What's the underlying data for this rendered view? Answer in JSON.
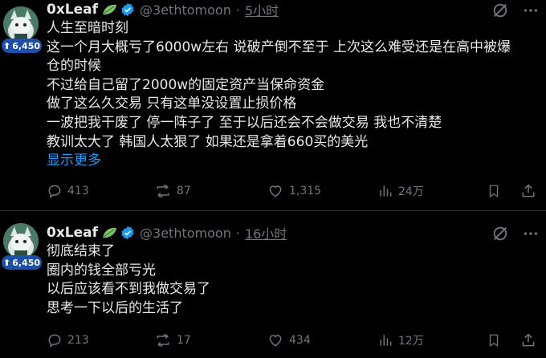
{
  "tweets": [
    {
      "author": "0xLeaf",
      "handle": "@3ethtomoon",
      "separator": "·",
      "time": "5小时",
      "badge_count": "6,450",
      "lines": [
        "人生至暗时刻",
        "这一个月大概亏了6000w左右 说破产倒不至于 上次这么难受还是在高中被爆",
        "仓的时候",
        "不过给自己留了2000w的固定资产当保命资金",
        "做了这么久交易 只有这单没设置止损价格",
        "一波把我干废了 停一阵子了 至于以后还会不会做交易 我也不清楚",
        "教训太大了 韩国人太狠了 如果还是拿着660买的美光"
      ],
      "show_more": "显示更多",
      "replies": "413",
      "reposts": "87",
      "likes": "1,315",
      "views": "24万"
    },
    {
      "author": "0xLeaf",
      "handle": "@3ethtomoon",
      "separator": "·",
      "time": "16小时",
      "badge_count": "6,450",
      "lines": [
        "彻底结束了",
        "圈内的钱全部亏光",
        "以后应该看不到我做交易了",
        "思考一下以后的生活了"
      ],
      "replies": "213",
      "reposts": "17",
      "likes": "434",
      "views": "12万"
    }
  ],
  "colors": {
    "accent": "#1d9bf0",
    "muted": "#71767b",
    "text": "#e7e9ea",
    "badge": "#1d4ea8"
  }
}
